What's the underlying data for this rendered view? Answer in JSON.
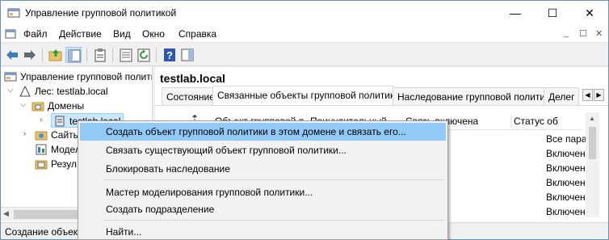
{
  "window": {
    "title": "Управление групповой политикой",
    "controls": {
      "minimize": "—",
      "maximize": "☐",
      "close": "✕"
    }
  },
  "menu": {
    "items": [
      "Файл",
      "Действие",
      "Вид",
      "Окно",
      "Справка"
    ],
    "mdi_controls": [
      "_",
      "☐",
      "✕"
    ]
  },
  "tree": {
    "items": [
      {
        "label": "Управление групповой полити"
      },
      {
        "label": "Лес: testlab.local"
      },
      {
        "label": "Домены"
      },
      {
        "label": "testlab.local"
      },
      {
        "label": "Сайты"
      },
      {
        "label": "Модел"
      },
      {
        "label": "Резул"
      }
    ]
  },
  "right": {
    "title": "testlab.local",
    "tabs": [
      "Состояние",
      "Связанные объекты групповой политики",
      "Наследование групповой политики",
      "Делег"
    ],
    "columns": [
      "Объект групповой полити",
      "Принудительный",
      "Связь включена",
      "Статус об"
    ],
    "status_values": [
      "Все пара",
      "Включен",
      "Включен",
      "Включен",
      "Включен",
      "Включен"
    ]
  },
  "status": {
    "text": "Создание объект"
  },
  "context_menu": {
    "items": [
      "Создать объект групповой политики в этом домене и связать его...",
      "Связать существующий объект групповой политики...",
      "Блокировать наследование",
      "Мастер моделирования групповой политики...",
      "Создать подразделение",
      "Найти..."
    ]
  }
}
